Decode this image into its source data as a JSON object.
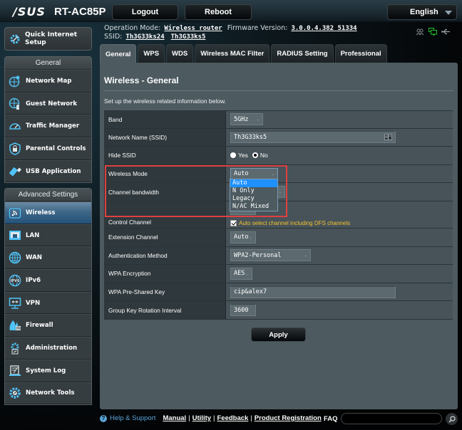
{
  "header": {
    "brand": "/SUS",
    "model": "RT-AC85P",
    "logout_label": "Logout",
    "reboot_label": "Reboot",
    "language": "English"
  },
  "info": {
    "operation_mode_label": "Operation Mode:",
    "operation_mode_value": "Wireless router",
    "firmware_label": "Firmware Version:",
    "firmware_value": "3.0.0.4.382_51334",
    "ssid_label": "SSID:",
    "ssid_24": "Th3G33ks24",
    "ssid_5": "Th3G33ks5",
    "status_icons": [
      "clients-icon",
      "network-connected-icon",
      "usb-icon"
    ],
    "status_colors": {
      "clients": "#6b7378",
      "network": "#22c32e",
      "usb": "#9aa3a8"
    }
  },
  "sidebar": {
    "quick_setup_label": "Quick Internet Setup",
    "general_header": "General",
    "general_items": [
      {
        "label": "Network Map",
        "icon": "network-map-icon"
      },
      {
        "label": "Guest Network",
        "icon": "guest-network-icon"
      },
      {
        "label": "Traffic Manager",
        "icon": "traffic-manager-icon"
      },
      {
        "label": "Parental Controls",
        "icon": "parental-controls-icon"
      },
      {
        "label": "USB Application",
        "icon": "usb-application-icon"
      }
    ],
    "advanced_header": "Advanced Settings",
    "advanced_items": [
      {
        "label": "Wireless",
        "icon": "wireless-icon",
        "active": true
      },
      {
        "label": "LAN",
        "icon": "lan-icon"
      },
      {
        "label": "WAN",
        "icon": "wan-icon"
      },
      {
        "label": "IPv6",
        "icon": "ipv6-icon"
      },
      {
        "label": "VPN",
        "icon": "vpn-icon"
      },
      {
        "label": "Firewall",
        "icon": "firewall-icon"
      },
      {
        "label": "Administration",
        "icon": "administration-icon"
      },
      {
        "label": "System Log",
        "icon": "system-log-icon"
      },
      {
        "label": "Network Tools",
        "icon": "network-tools-icon"
      }
    ],
    "accent_color": "#4fc3f7",
    "active_color": "#2c5a80"
  },
  "tabs": [
    {
      "label": "General",
      "active": true
    },
    {
      "label": "WPS"
    },
    {
      "label": "WDS"
    },
    {
      "label": "Wireless MAC Filter"
    },
    {
      "label": "RADIUS Setting"
    },
    {
      "label": "Professional"
    }
  ],
  "main": {
    "title": "Wireless - General",
    "description": "Set up the wireless related information below.",
    "fields": {
      "band": {
        "label": "Band",
        "value": "5GHz"
      },
      "ssid": {
        "label": "Network Name (SSID)",
        "value": "Th3G33ks5"
      },
      "hide_ssid": {
        "label": "Hide SSID",
        "yes": "Yes",
        "no": "No",
        "selected": "No"
      },
      "wireless_mode": {
        "label": "Wireless Mode",
        "value": "Auto",
        "options": [
          "Auto",
          "N Only",
          "Legacy",
          "N/AC Mixed"
        ],
        "highlighted": "Auto"
      },
      "channel_bandwidth": {
        "label": "Channel bandwidth"
      },
      "control_channel": {
        "label": "Control Channel",
        "dfs_label": "Auto select channel including DFS channels",
        "dfs_checked": true
      },
      "extension_channel": {
        "label": "Extension Channel",
        "value": "Auto"
      },
      "auth_method": {
        "label": "Authentication Method",
        "value": "WPA2-Personal"
      },
      "wpa_encryption": {
        "label": "WPA Encryption",
        "value": "AES"
      },
      "wpa_psk": {
        "label": "WPA Pre-Shared Key",
        "value": "cip&alex7"
      },
      "group_key_interval": {
        "label": "Group Key Rotation Interval",
        "value": "3600"
      }
    },
    "apply_label": "Apply"
  },
  "footer": {
    "help_label": "Help & Support",
    "links": [
      "Manual",
      "Utility",
      "Feedback",
      "Product Registration"
    ],
    "faq_label": "FAQ",
    "faq_value": ""
  }
}
